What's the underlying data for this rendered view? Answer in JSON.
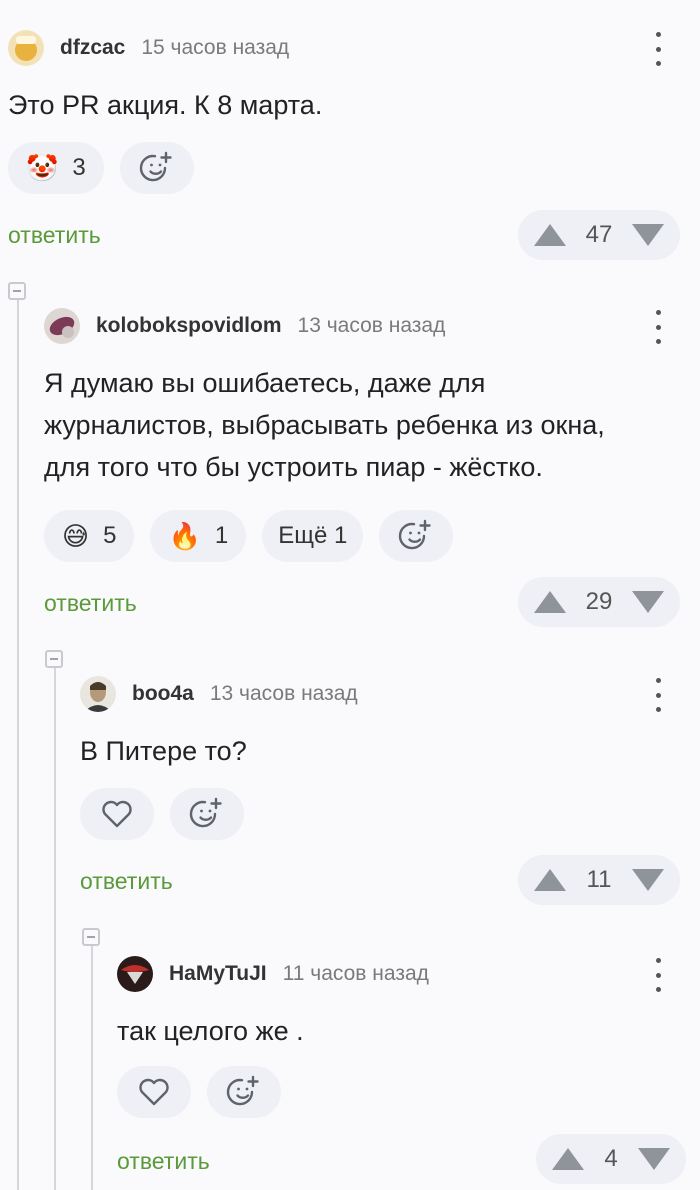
{
  "comments": [
    {
      "username": "dfzcac",
      "time": "15 часов назад",
      "text": "Это PR акция. К 8 марта.",
      "reactions": [
        {
          "emoji": "🤡",
          "count": "3"
        }
      ],
      "reply_label": "ответить",
      "score": "47"
    },
    {
      "username": "kolobokspovidlom",
      "time": "13 часов назад",
      "text": "Я думаю вы ошибаетесь, даже для\nжурналистов, выбрасывать ребенка из окна,\nдля того что бы устроить пиар - жёстко.",
      "reactions": [
        {
          "emoji": "😅",
          "count": "5"
        },
        {
          "emoji": "🔥",
          "count": "1"
        }
      ],
      "more_label": "Ещё 1",
      "reply_label": "ответить",
      "score": "29"
    },
    {
      "username": "boo4a",
      "time": "13 часов назад",
      "text": "В Питере то?",
      "reply_label": "ответить",
      "score": "11"
    },
    {
      "username": "HaMyTuJI",
      "time": "11 часов назад",
      "text": "так целого же .",
      "reply_label": "ответить",
      "score": "4"
    }
  ],
  "icons": {
    "add_reaction": "smile-plus-icon",
    "like": "heart-icon",
    "menu": "more-vertical-icon",
    "upvote": "arrow-up-icon",
    "downvote": "arrow-down-icon"
  },
  "colors": {
    "background": "#fafafc",
    "reply_link": "#5a9a3a",
    "pill_bg": "#eef0f5",
    "muted": "#7a7a7a"
  }
}
